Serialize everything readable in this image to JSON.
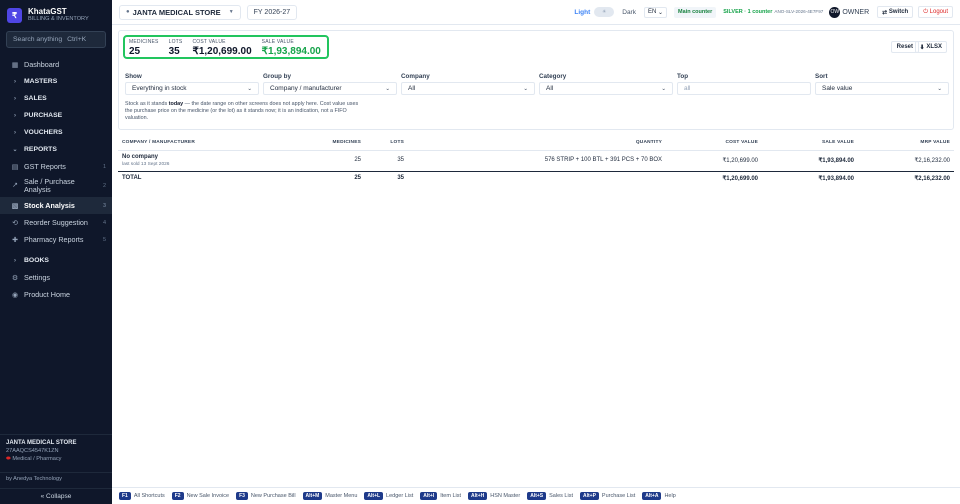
{
  "sidebar": {
    "brand_title": "KhataGST",
    "brand_sub": "BILLING & INVENTORY",
    "logo_letter": "₹",
    "search_placeholder": "Search anything",
    "search_shortcut": "Ctrl+K",
    "items": [
      {
        "label": "Dashboard",
        "icon": "▦"
      },
      {
        "label": "MASTERS",
        "icon": "›"
      },
      {
        "label": "SALES",
        "icon": "›"
      },
      {
        "label": "PURCHASE",
        "icon": "›"
      },
      {
        "label": "VOUCHERS",
        "icon": "›"
      },
      {
        "label": "REPORTS",
        "icon": "⌄"
      },
      {
        "label": "GST Reports",
        "num": "1",
        "icon": "▤"
      },
      {
        "label": "Sale / Purchase Analysis",
        "num": "2",
        "icon": "↗"
      },
      {
        "label": "Stock Analysis",
        "num": "3",
        "icon": "▧"
      },
      {
        "label": "Reorder Suggestion",
        "num": "4",
        "icon": "⟲"
      },
      {
        "label": "Pharmacy Reports",
        "num": "5",
        "icon": "✚"
      },
      {
        "label": "BOOKS",
        "icon": "›"
      },
      {
        "label": "Settings",
        "icon": "⚙"
      },
      {
        "label": "Product Home",
        "icon": "◉"
      }
    ],
    "store_name": "JANTA MEDICAL STORE",
    "gstin": "27AAQCS4547K1ZN",
    "store_type": "Medical / Pharmacy",
    "by": "by Anedya Technology",
    "collapse": "« Collapse"
  },
  "topbar": {
    "store": "JANTA MEDICAL STORE",
    "fy": "FY 2026-27",
    "light": "Light",
    "dark": "Dark",
    "lang": "EN",
    "counter": "Main counter",
    "license": "SILVER · 1 counter",
    "license_code": "ANO-SLV-2026-4E7F97",
    "avatar": "OW",
    "role": "OWNER",
    "switch": "Switch",
    "logout": "Logout"
  },
  "stats": {
    "medicines_label": "MEDICINES",
    "medicines": "25",
    "lots_label": "LOTS",
    "lots": "35",
    "cost_label": "COST VALUE",
    "cost": "₹1,20,699.00",
    "sale_label": "SALE VALUE",
    "sale": "₹1,93,894.00",
    "reset": "Reset",
    "xlsx": "XLSX"
  },
  "filters": {
    "show_label": "Show",
    "show": "Everything in stock",
    "group_label": "Group by",
    "group": "Company / manufacturer",
    "company_label": "Company",
    "company": "All",
    "category_label": "Category",
    "category": "All",
    "top_label": "Top",
    "top_placeholder": "all",
    "sort_label": "Sort",
    "sort": "Sale value"
  },
  "note": {
    "a": "Stock as it stands ",
    "b": "today",
    "c": " — the date range on other screens does not apply here. Cost value uses the purchase price on the medicine (or the lot) as it stands now; it is an indication, not a FIFO valuation."
  },
  "table": {
    "headers": {
      "company": "COMPANY / MANUFACTURER",
      "medicines": "MEDICINES",
      "lots": "LOTS",
      "quantity": "QUANTITY",
      "cost": "COST VALUE",
      "sale": "SALE VALUE",
      "mrp": "MRP VALUE"
    },
    "row": {
      "company": "No company",
      "last_sold": "last sold 13 Sept 2026",
      "medicines": "25",
      "lots": "35",
      "quantity": "576 STRIP + 100 BTL + 391 PCS + 70 BOX",
      "cost": "₹1,20,699.00",
      "sale": "₹1,93,894.00",
      "mrp": "₹2,16,232.00"
    },
    "total": {
      "label": "TOTAL",
      "medicines": "25",
      "lots": "35",
      "cost": "₹1,20,699.00",
      "sale": "₹1,93,894.00",
      "mrp": "₹2,16,232.00"
    }
  },
  "shortcuts": [
    {
      "key": "F1",
      "label": "All Shortcuts"
    },
    {
      "key": "F2",
      "label": "New Sale Invoice"
    },
    {
      "key": "F3",
      "label": "New Purchase Bill"
    },
    {
      "key": "Alt+M",
      "label": "Master Menu"
    },
    {
      "key": "Alt+L",
      "label": "Ledger List"
    },
    {
      "key": "Alt+I",
      "label": "Item List"
    },
    {
      "key": "Alt+H",
      "label": "HSN Master"
    },
    {
      "key": "Alt+S",
      "label": "Sales List"
    },
    {
      "key": "Alt+P",
      "label": "Purchase List"
    },
    {
      "key": "Alt+A",
      "label": "Help"
    }
  ]
}
